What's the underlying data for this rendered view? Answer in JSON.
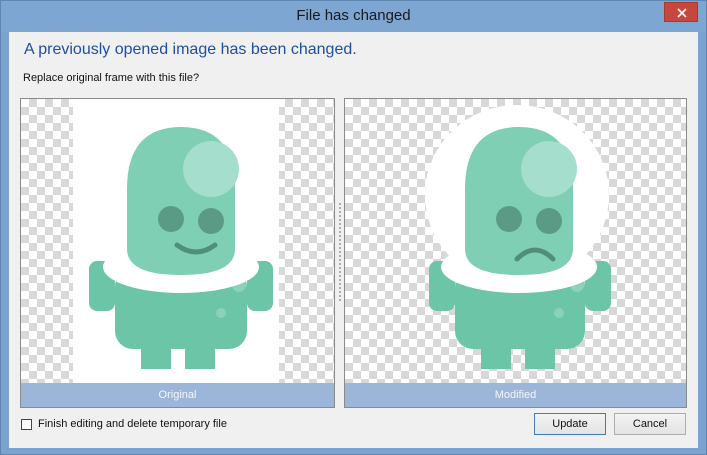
{
  "window": {
    "title": "File has changed"
  },
  "dialog": {
    "heading": "A previously opened image has been changed.",
    "question": "Replace original frame with this file?"
  },
  "panels": {
    "original_label": "Original",
    "modified_label": "Modified"
  },
  "footer": {
    "checkbox_label": "Finish editing and delete temporary file",
    "checkbox_checked": false,
    "update_label": "Update",
    "cancel_label": "Cancel"
  },
  "colors": {
    "heading": "#1e4fa0",
    "creature": "#6cc5a6",
    "caption_bar": "#9bb6d8"
  }
}
